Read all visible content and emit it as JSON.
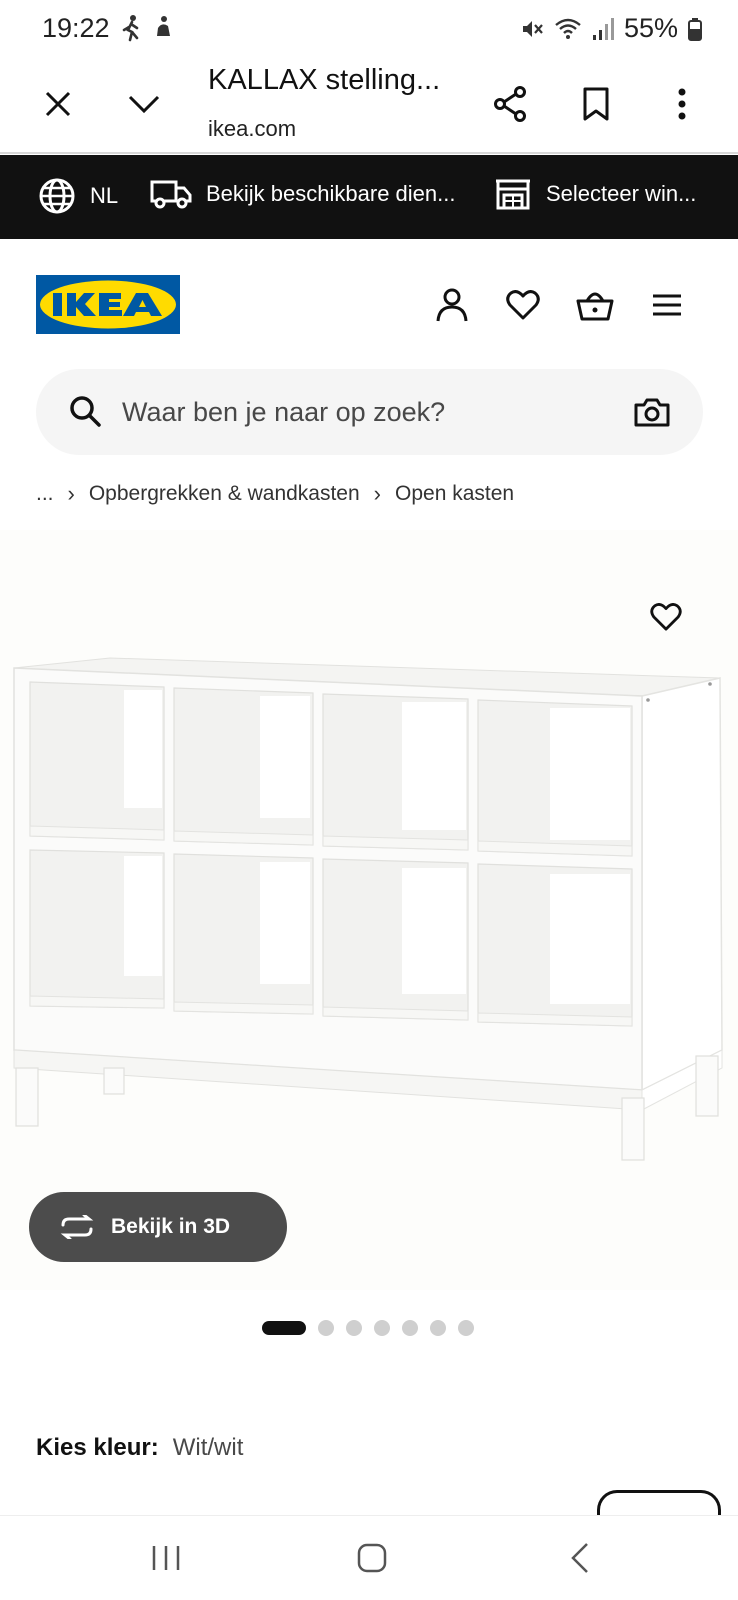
{
  "status": {
    "time": "19:22",
    "battery": "55%"
  },
  "browser": {
    "title": "KALLAX stelling...",
    "domain": "ikea.com"
  },
  "service_bar": {
    "language": "NL",
    "delivery": "Bekijk beschikbare dien...",
    "store": "Selecteer win..."
  },
  "search": {
    "placeholder": "Waar ben je naar op zoek?"
  },
  "breadcrumb": {
    "ellipsis": "...",
    "items": [
      "Opbergrekken & wandkasten",
      "Open kasten"
    ]
  },
  "product": {
    "view_3d_label": "Bekijk in 3D",
    "carousel": {
      "count": 7,
      "active": 0
    }
  },
  "color": {
    "label": "Kies kleur:",
    "value": "Wit/wit"
  },
  "colors": {
    "ikea_blue": "#0058a3",
    "ikea_yellow": "#ffdb00",
    "service_bar": "#111111"
  }
}
